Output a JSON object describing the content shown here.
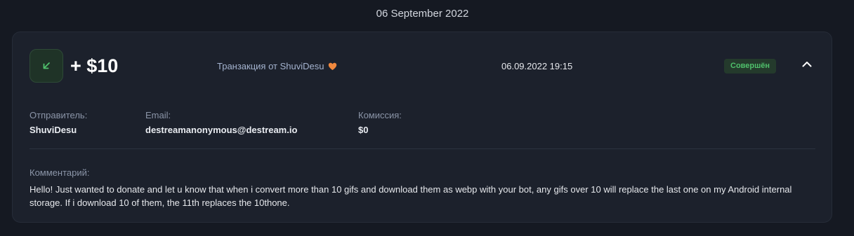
{
  "date_header": "06 September 2022",
  "transaction": {
    "icon": "arrow-down-left-icon",
    "amount": "+ $10",
    "from_text": "Транзакция от ShuviDesu",
    "heart_icon": "heart-icon",
    "datetime": "06.09.2022 19:15",
    "status": "Совершён",
    "collapse_icon": "chevron-up-icon"
  },
  "details": {
    "sender_label": "Отправитель:",
    "sender_value": "ShuviDesu",
    "email_label": "Email:",
    "email_value": "destreamanonymous@destream.io",
    "fee_label": "Комиссия:",
    "fee_value": "$0"
  },
  "comment": {
    "label": "Комментарий:",
    "text": "Hello! Just wanted to donate and let u know that when i convert more than 10 gifs and download them as webp with your bot, any gifs over 10 will replace the last one on my Android internal storage. If i download 10 of them, the 11th replaces the 10thone."
  },
  "colors": {
    "background": "#151922",
    "card": "#1c212c",
    "accent_green": "#4fbf6b",
    "heart_orange": "#f0883e"
  }
}
